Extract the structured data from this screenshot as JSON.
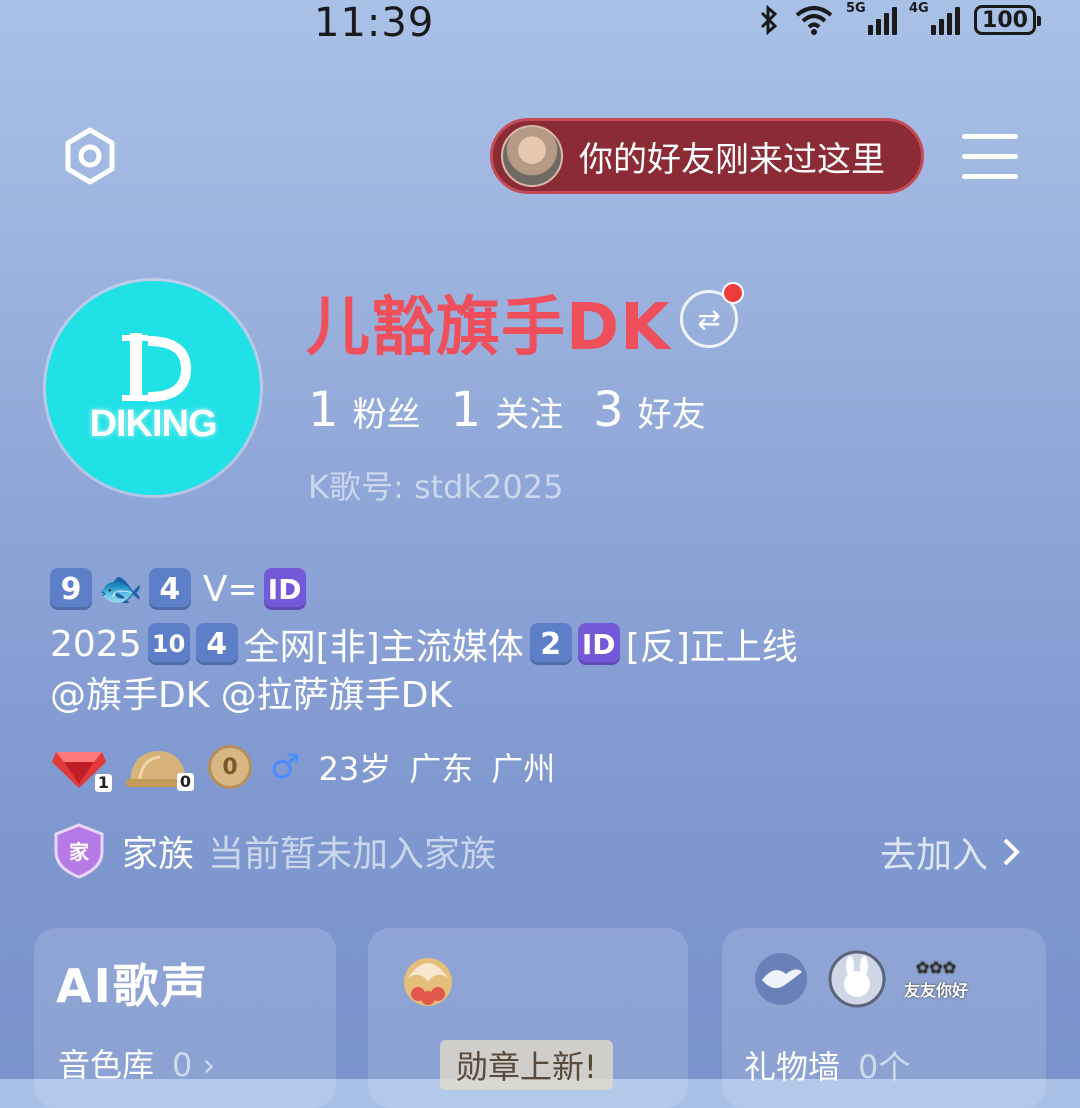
{
  "status_bar": {
    "time": "11:39",
    "battery": "100",
    "net1": "5G",
    "net2": "4G"
  },
  "header": {
    "friend_visit_text": "你的好友刚来过这里"
  },
  "profile": {
    "avatar_logo_text": "DIKING",
    "nickname": "儿豁旗手DK",
    "stats": [
      {
        "value": "1",
        "label": "粉丝"
      },
      {
        "value": "1",
        "label": "关注"
      },
      {
        "value": "3",
        "label": "好友"
      }
    ],
    "kge_id": "K歌号: stdk2025"
  },
  "bio": {
    "line1": {
      "k1": "9",
      "k2": "4",
      "v": "V=",
      "id": "ID"
    },
    "line2": {
      "year": "2025",
      "k1": "10",
      "k2": "4",
      "text1": "全网[非]主流媒体",
      "k3": "2",
      "id": "ID",
      "text2": "[反]正上线"
    },
    "line3": "@旗手DK @拉萨旗手DK"
  },
  "meta": {
    "gem_level": "1",
    "helmet_count": "0",
    "coin_count": "0",
    "gender_symbol": "♂",
    "age": "23岁",
    "province": "广东",
    "city": "广州"
  },
  "family": {
    "badge": "家",
    "title": "家族",
    "status": "当前暂未加入家族",
    "join_label": "去加入"
  },
  "cards": {
    "ai_voice": {
      "title": "AI歌声",
      "timbre_label": "音色库",
      "timbre_count": "0"
    },
    "medal": {
      "pill": "勋章上新!"
    },
    "gift": {
      "badge_text": "友友你好",
      "wall_label": "礼物墙",
      "wall_count": "0个"
    }
  }
}
